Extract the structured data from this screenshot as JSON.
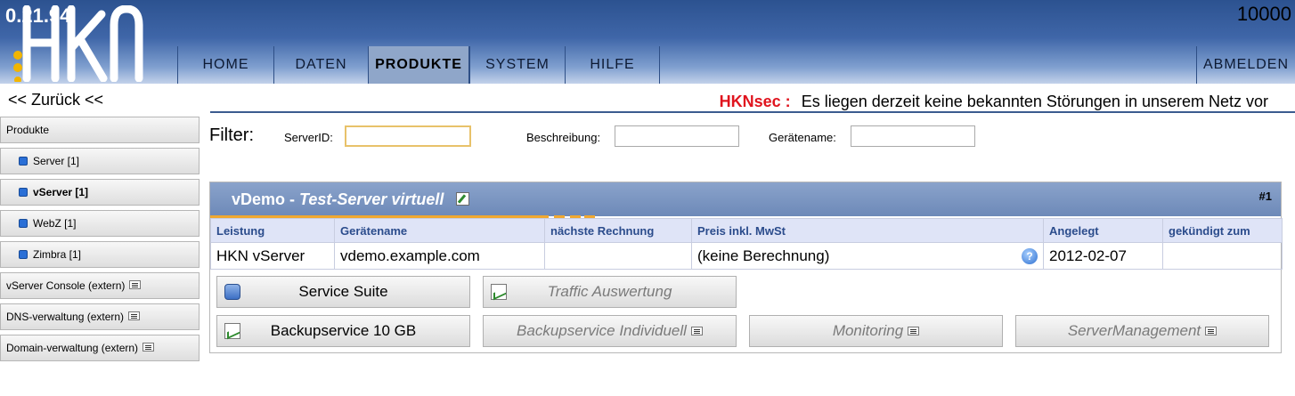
{
  "header": {
    "version": "0.21.94",
    "logo_text": "HKN",
    "counter": "10000",
    "nav": [
      {
        "label": "HOME"
      },
      {
        "label": "DATEN"
      },
      {
        "label": "PRODUKTE"
      },
      {
        "label": "SYSTEM"
      },
      {
        "label": "HILFE"
      }
    ],
    "logout": "ABMELDEN"
  },
  "subheader": {
    "back": "<< Zurück <<",
    "status_label": "HKNsec :",
    "status_text": "Es liegen derzeit keine bekannten Störungen in unserem Netz vor"
  },
  "sidebar": {
    "items": [
      {
        "label": "Produkte"
      },
      {
        "label": "Server [1]"
      },
      {
        "label": "vServer [1]"
      },
      {
        "label": "WebZ [1]"
      },
      {
        "label": "Zimbra [1]"
      },
      {
        "label": "vServer Console (extern)"
      },
      {
        "label": "DNS-verwaltung (extern)"
      },
      {
        "label": "Domain-verwaltung (extern)"
      }
    ]
  },
  "filter": {
    "title": "Filter:",
    "fields": [
      {
        "label": "ServerID:",
        "value": ""
      },
      {
        "label": "Beschreibung:",
        "value": ""
      },
      {
        "label": "Gerätename:",
        "value": ""
      }
    ]
  },
  "panel": {
    "title_main": "vDemo - ",
    "title_italic": "Test-Server virtuell",
    "number": "#1",
    "columns": [
      "Leistung",
      "Gerätename",
      "nächste Rechnung",
      "Preis inkl. MwSt",
      "Angelegt",
      "gekündigt zum"
    ],
    "row": [
      "HKN vServer",
      "vdemo.example.com",
      "",
      "(keine Berechnung)",
      "2012-02-07",
      ""
    ],
    "help_glyph": "?",
    "buttons": [
      {
        "label": "Service Suite",
        "icon": "database-icon"
      },
      {
        "label": "Traffic Auswertung",
        "icon": "chart-icon"
      },
      {
        "label": "Backupservice 10 GB",
        "icon": "chart-icon"
      },
      {
        "label": "Backupservice Individuell"
      },
      {
        "label": "Monitoring"
      },
      {
        "label": "ServerManagement"
      }
    ]
  }
}
